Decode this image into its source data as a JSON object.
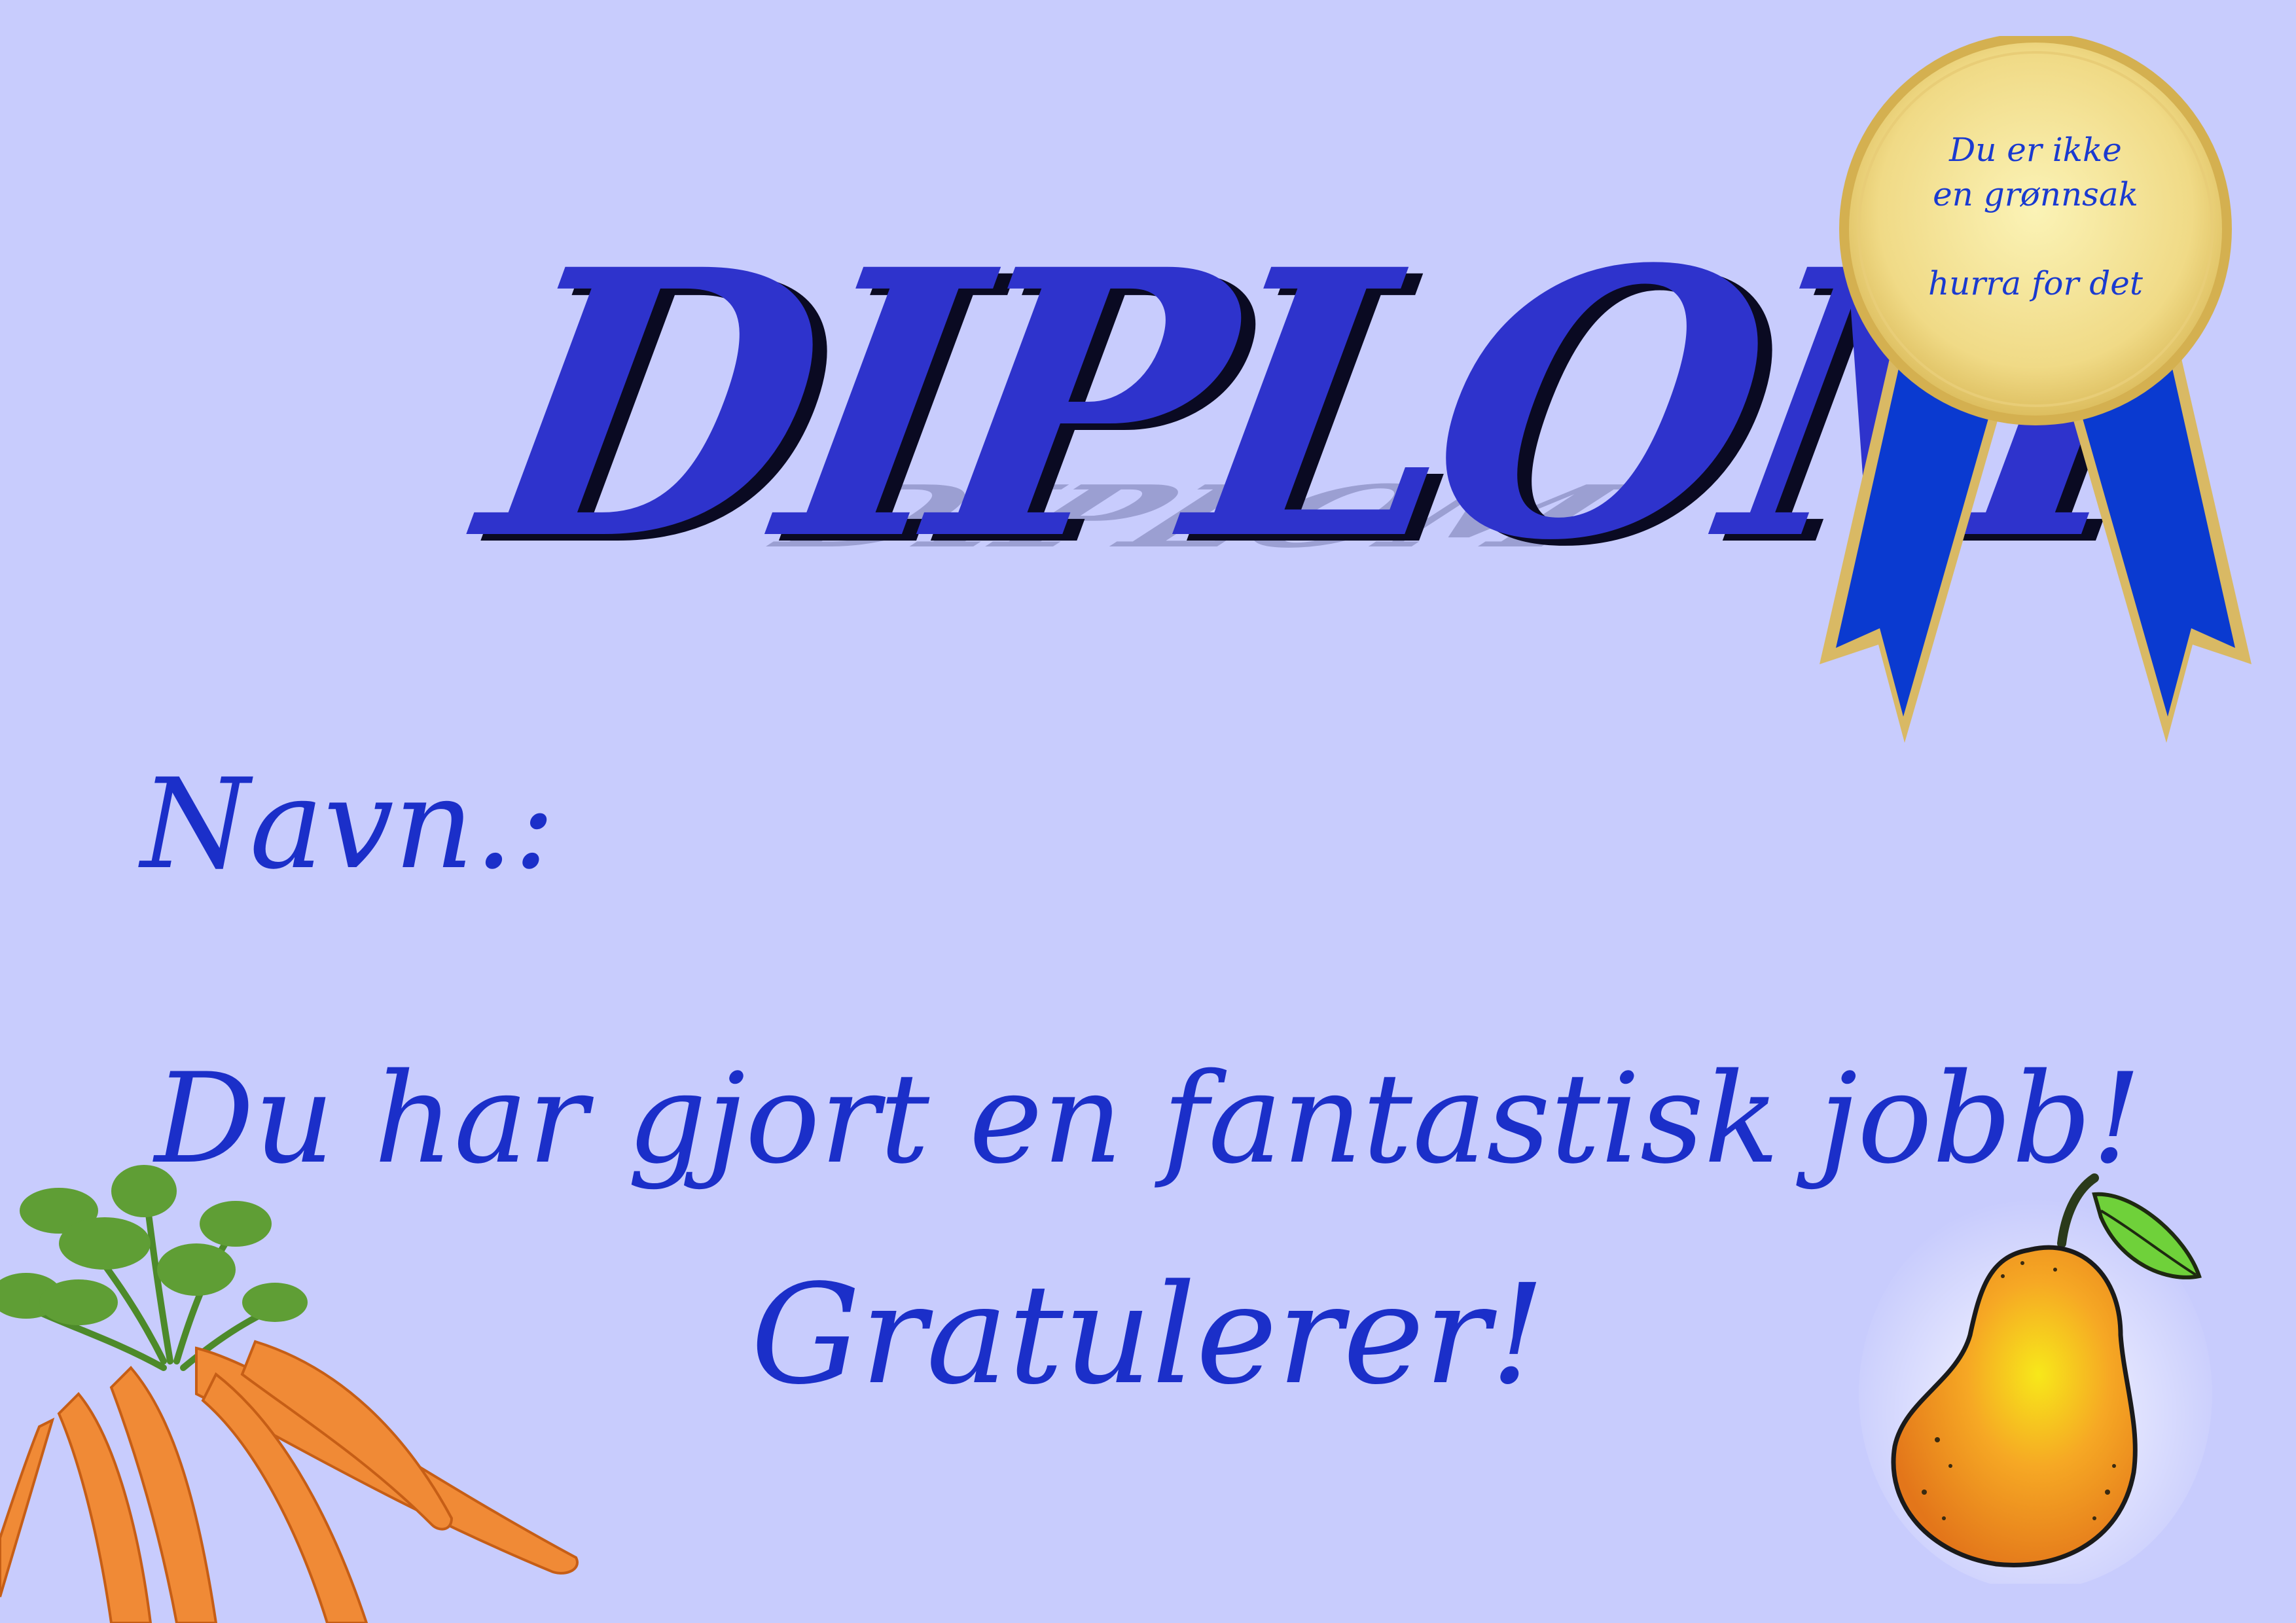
{
  "title": "DIPLOM",
  "name_label": "Navn.:",
  "message": "Du har gjort en fantastisk jobb!",
  "congratulations": "Gratulerer!",
  "medal": {
    "line1": "Du er ikke",
    "line2": "en grønnsak",
    "line3": "hurra for det"
  },
  "colors": {
    "background": "#c8ccfd",
    "title": "#2e33cc",
    "text": "#1b2fc9",
    "medal_gold": "#f2dd8c",
    "ribbon": "#0a3ad0"
  },
  "images": {
    "bottom_left": "carrots-illustration",
    "bottom_right": "pear-illustration",
    "top_right": "award-ribbon-medal"
  }
}
